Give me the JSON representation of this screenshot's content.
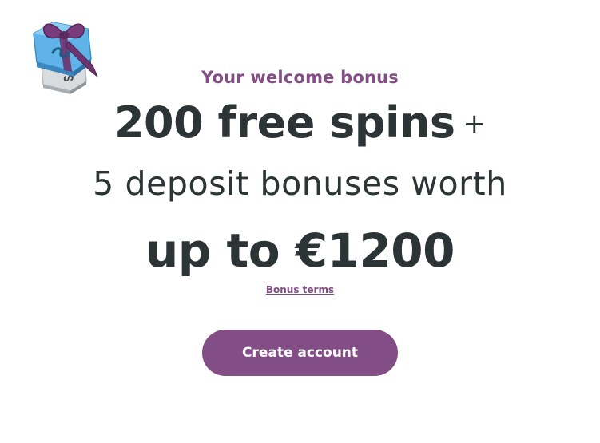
{
  "promo": {
    "welcome_label": "Your welcome bonus",
    "spins_headline": "200 free spins",
    "plus_sign": "+",
    "deposit_line": "5 deposit bonuses worth",
    "amount_line": "up to €1200",
    "terms_link": "Bonus terms",
    "cta_label": "Create account",
    "icon": "gift-box-icon"
  },
  "colors": {
    "accent": "#834d86",
    "text": "#2d3436",
    "background": "#ffffff",
    "gift_blue": "#55a8e0",
    "gift_ribbon": "#6d3570"
  }
}
